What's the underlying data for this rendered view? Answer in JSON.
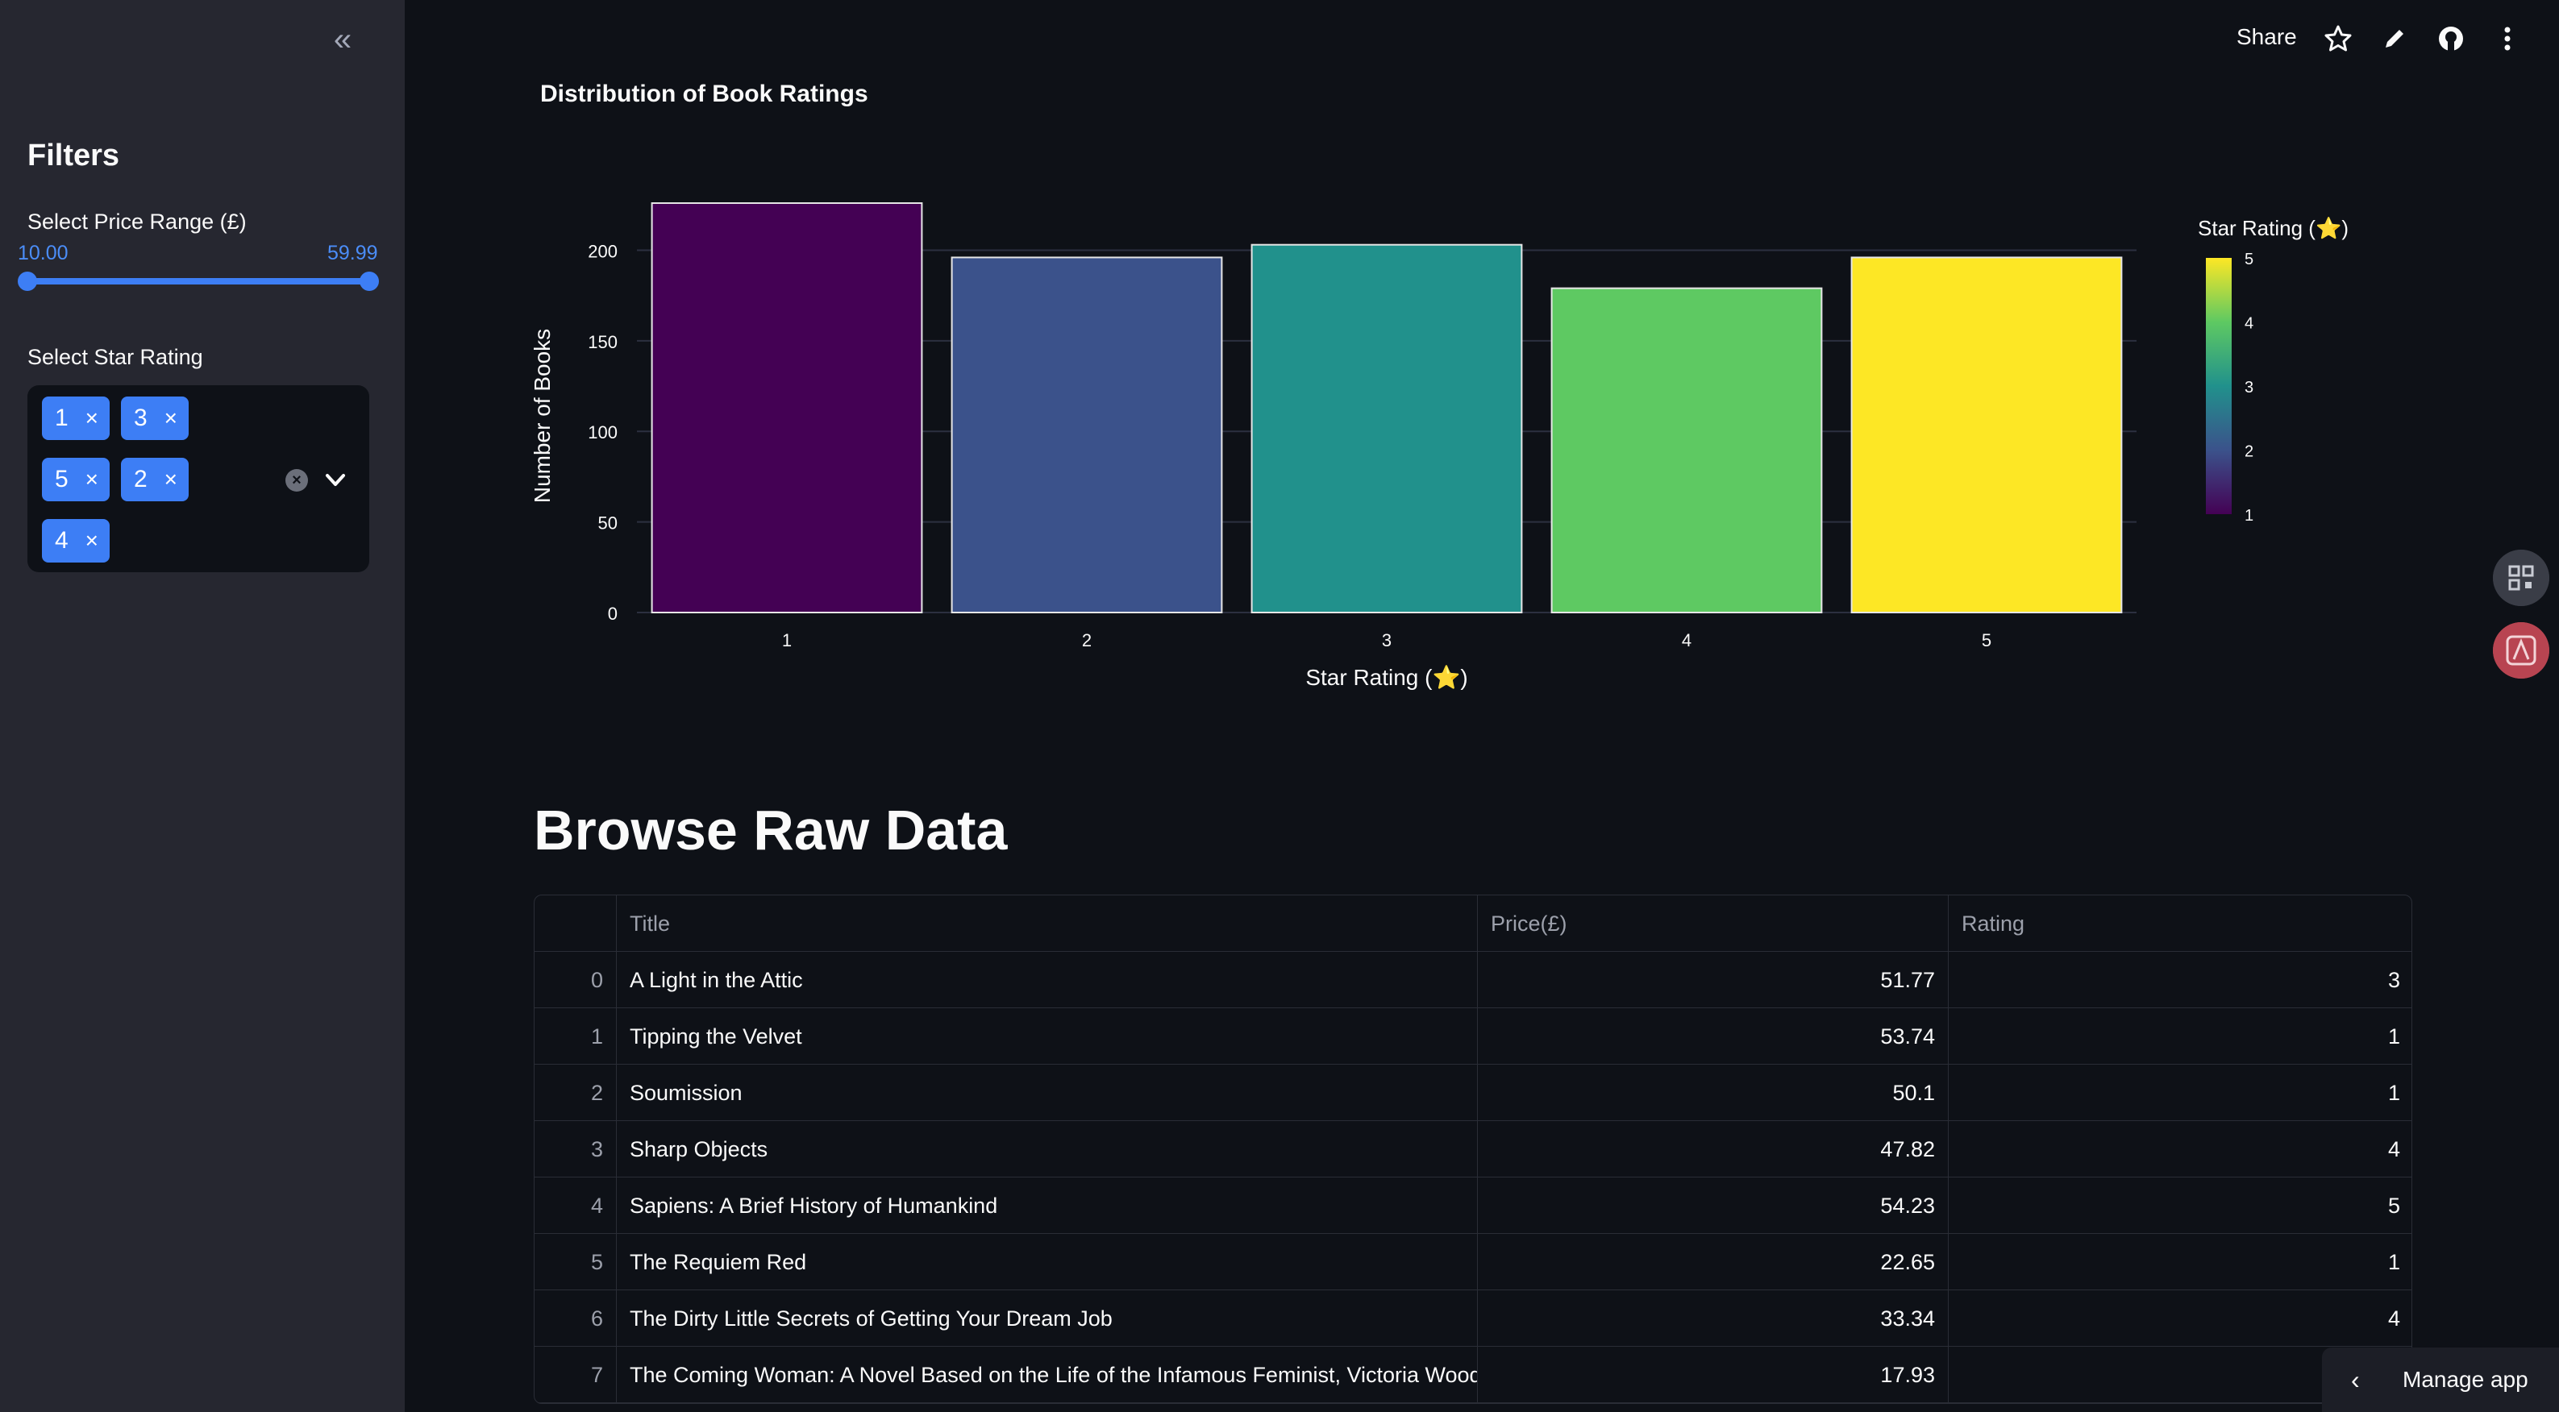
{
  "sidebar": {
    "collapse_icon": "«",
    "filters_title": "Filters",
    "price_label": "Select Price Range (£)",
    "price_min": "10.00",
    "price_max": "59.99",
    "rating_label": "Select Star Rating",
    "selected_ratings": [
      "1",
      "3",
      "5",
      "2",
      "4"
    ],
    "chip_remove": "×",
    "clear_icon": "×"
  },
  "header": {
    "share_label": "Share",
    "icons": [
      "star-icon",
      "pencil-icon",
      "github-icon",
      "more-icon"
    ]
  },
  "chart_data": {
    "type": "bar",
    "title": "Distribution of Book Ratings",
    "xlabel": "Star Rating (⭐)",
    "ylabel": "Number of Books",
    "categories": [
      "1",
      "2",
      "3",
      "4",
      "5"
    ],
    "values": [
      226,
      196,
      203,
      179,
      196
    ],
    "colors": [
      "#440154",
      "#3b528b",
      "#21918c",
      "#5ec962",
      "#fde725"
    ],
    "yticks": [
      "0",
      "50",
      "100",
      "150",
      "200"
    ],
    "ylim": [
      0,
      226
    ],
    "grid": true,
    "colorbar": {
      "title": "Star Rating (⭐)",
      "ticks": [
        "1",
        "2",
        "3",
        "4",
        "5"
      ]
    }
  },
  "main": {
    "browse_title": "Browse Raw Data",
    "table": {
      "columns": [
        "",
        "Title",
        "Price(£)",
        "Rating"
      ],
      "rows": [
        {
          "idx": "0",
          "title": "A Light in the Attic",
          "price": "51.77",
          "rating": "3"
        },
        {
          "idx": "1",
          "title": "Tipping the Velvet",
          "price": "53.74",
          "rating": "1"
        },
        {
          "idx": "2",
          "title": "Soumission",
          "price": "50.1",
          "rating": "1"
        },
        {
          "idx": "3",
          "title": "Sharp Objects",
          "price": "47.82",
          "rating": "4"
        },
        {
          "idx": "4",
          "title": "Sapiens: A Brief History of Humankind",
          "price": "54.23",
          "rating": "5"
        },
        {
          "idx": "5",
          "title": "The Requiem Red",
          "price": "22.65",
          "rating": "1"
        },
        {
          "idx": "6",
          "title": "The Dirty Little Secrets of Getting Your Dream Job",
          "price": "33.34",
          "rating": "4"
        },
        {
          "idx": "7",
          "title": "The Coming Woman: A Novel Based on the Life of the Infamous Feminist, Victoria Woodhul",
          "price": "17.93",
          "rating": ""
        }
      ]
    }
  },
  "manage_app": {
    "label": "Manage app",
    "chevron": "‹"
  }
}
